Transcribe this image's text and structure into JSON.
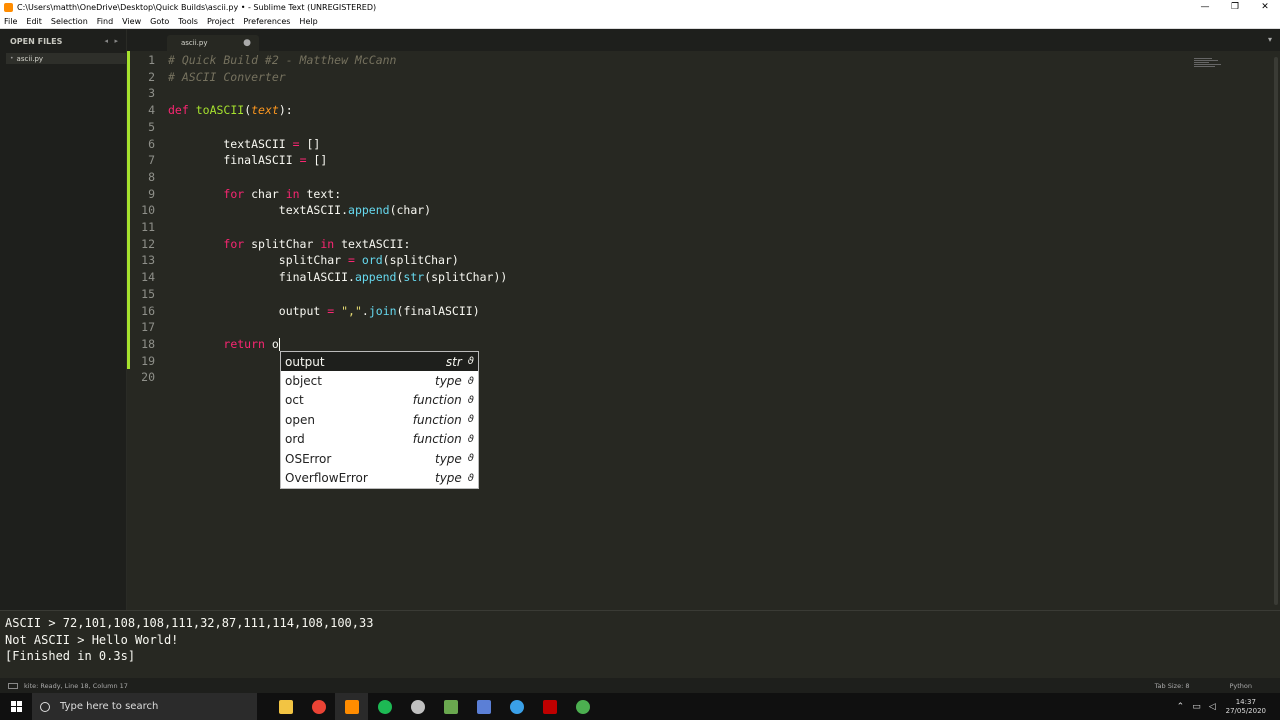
{
  "window": {
    "title": "C:\\Users\\matth\\OneDrive\\Desktop\\Quick Builds\\ascii.py • - Sublime Text (UNREGISTERED)",
    "controls": {
      "minimize": "—",
      "maximize": "❐",
      "close": "✕"
    }
  },
  "menu": [
    "File",
    "Edit",
    "Selection",
    "Find",
    "View",
    "Goto",
    "Tools",
    "Project",
    "Preferences",
    "Help"
  ],
  "sidebar": {
    "header": "OPEN FILES",
    "nav_arrows": "◂ ▸",
    "files": [
      {
        "name": "ascii.py"
      }
    ]
  },
  "tab": {
    "label": "ascii.py",
    "modified_marker": "●",
    "dropdown": "▾"
  },
  "editor": {
    "line_numbers": [
      "1",
      "2",
      "3",
      "4",
      "5",
      "6",
      "7",
      "8",
      "9",
      "10",
      "11",
      "12",
      "13",
      "14",
      "15",
      "16",
      "17",
      "18",
      "19",
      "20"
    ],
    "lines": [
      [
        {
          "t": "# Quick Build #2 - Matthew McCann",
          "c": "comment"
        }
      ],
      [
        {
          "t": "# ASCII Converter",
          "c": "comment"
        }
      ],
      [],
      [
        {
          "t": "def",
          "c": "kw"
        },
        {
          "t": " "
        },
        {
          "t": "toASCII",
          "c": "fn"
        },
        {
          "t": "("
        },
        {
          "t": "text",
          "c": "param"
        },
        {
          "t": "):"
        }
      ],
      [],
      [
        {
          "t": "        textASCII "
        },
        {
          "t": "=",
          "c": "kw"
        },
        {
          "t": " []"
        }
      ],
      [
        {
          "t": "        finalASCII "
        },
        {
          "t": "=",
          "c": "kw"
        },
        {
          "t": " []"
        }
      ],
      [],
      [
        {
          "t": "        "
        },
        {
          "t": "for",
          "c": "kw"
        },
        {
          "t": " char "
        },
        {
          "t": "in",
          "c": "kw"
        },
        {
          "t": " text:"
        }
      ],
      [
        {
          "t": "                textASCII."
        },
        {
          "t": "append",
          "c": "builtin"
        },
        {
          "t": "(char)"
        }
      ],
      [],
      [
        {
          "t": "        "
        },
        {
          "t": "for",
          "c": "kw"
        },
        {
          "t": " splitChar "
        },
        {
          "t": "in",
          "c": "kw"
        },
        {
          "t": " textASCII:"
        }
      ],
      [
        {
          "t": "                splitChar "
        },
        {
          "t": "=",
          "c": "kw"
        },
        {
          "t": " "
        },
        {
          "t": "ord",
          "c": "builtin"
        },
        {
          "t": "(splitChar)"
        }
      ],
      [
        {
          "t": "                finalASCII."
        },
        {
          "t": "append",
          "c": "builtin"
        },
        {
          "t": "("
        },
        {
          "t": "str",
          "c": "builtin"
        },
        {
          "t": "(splitChar))"
        }
      ],
      [],
      [
        {
          "t": "                output "
        },
        {
          "t": "=",
          "c": "kw"
        },
        {
          "t": " "
        },
        {
          "t": "\",\"",
          "c": "str"
        },
        {
          "t": "."
        },
        {
          "t": "join",
          "c": "builtin"
        },
        {
          "t": "(finalASCII)"
        }
      ],
      [],
      [
        {
          "t": "        "
        },
        {
          "t": "return",
          "c": "kw"
        },
        {
          "t": " o"
        },
        {
          "t": "",
          "c": "cursor"
        }
      ],
      [],
      []
    ]
  },
  "autocomplete": [
    {
      "name": "output",
      "kind": "str",
      "icon": "ϑ"
    },
    {
      "name": "object",
      "kind": "type",
      "icon": "ϑ"
    },
    {
      "name": "oct",
      "kind": "function",
      "icon": "ϑ"
    },
    {
      "name": "open",
      "kind": "function",
      "icon": "ϑ"
    },
    {
      "name": "ord",
      "kind": "function",
      "icon": "ϑ"
    },
    {
      "name": "OSError",
      "kind": "type",
      "icon": "ϑ"
    },
    {
      "name": "OverflowError",
      "kind": "type",
      "icon": "ϑ"
    }
  ],
  "output_panel": {
    "lines": [
      "ASCII > 72,101,108,108,111,32,87,111,114,108,100,33",
      "Not ASCII > Hello World!",
      "[Finished in 0.3s]"
    ]
  },
  "status": {
    "message": "kite: Ready, Line 18, Column 17",
    "tab_size": "Tab Size: 8",
    "syntax": "Python"
  },
  "taskbar": {
    "search_placeholder": "Type here to search",
    "time": "14:37",
    "date": "27/05/2020"
  },
  "colors": {
    "background": "#272822",
    "comment": "#75715e",
    "keyword": "#f92672",
    "function": "#a6e22e",
    "builtin": "#66d9ef",
    "string": "#e6db74",
    "param": "#fd971f"
  }
}
